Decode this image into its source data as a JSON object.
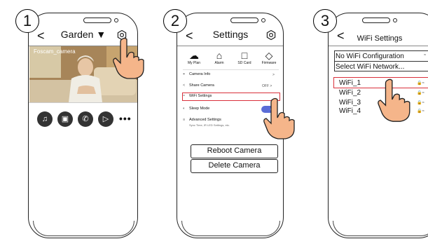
{
  "steps": [
    "1",
    "2",
    "3"
  ],
  "panel1": {
    "back_symbol": "<",
    "title": "Garden ▼",
    "gear_icon": "gear-icon",
    "camera_label": "Foscam_camera",
    "controls": [
      {
        "name": "alarm-icon",
        "glyph": "♫"
      },
      {
        "name": "snapshot-icon",
        "glyph": "▣"
      },
      {
        "name": "call-icon",
        "glyph": "✆"
      },
      {
        "name": "record-icon",
        "glyph": "▷"
      }
    ],
    "more_label": "•••"
  },
  "panel2": {
    "back_symbol": "<",
    "title": "Settings",
    "quick_actions": [
      {
        "label": "My Plan",
        "glyph": "☁"
      },
      {
        "label": "Alarm",
        "glyph": "⌂"
      },
      {
        "label": "SD Card",
        "glyph": "□"
      },
      {
        "label": "Firmware",
        "glyph": "◇"
      }
    ],
    "rows": [
      {
        "icon": "⌖",
        "label": "Camera Info",
        "value": ">"
      },
      {
        "icon": "<",
        "label": "Share Camera",
        "value": "OFF >"
      },
      {
        "icon": "≈",
        "label": "WiFi Settings",
        "value": ""
      },
      {
        "icon": "◐",
        "label": "Sleep Mode",
        "value": ""
      },
      {
        "icon": "≡",
        "label": "Advanced Settings",
        "value": "",
        "sub": "Sync Time, IR LED Settings, etc."
      }
    ],
    "buttons": {
      "reboot": "Reboot Camera",
      "delete": "Delete Camera"
    },
    "accent_toggle": "#5a6cd6",
    "highlight_color": "#d9303b"
  },
  "panel3": {
    "back_symbol": "<",
    "title": "WiFi Settings",
    "options": [
      "No WiFi Configuration",
      "Select WiFi Network..."
    ],
    "networks": [
      "WiFi_1",
      "WiFi_2",
      "WiFi_3",
      "WiFi_4"
    ],
    "lock_wifi_glyph": "🔒≈",
    "wifi_glyph": "≈"
  }
}
